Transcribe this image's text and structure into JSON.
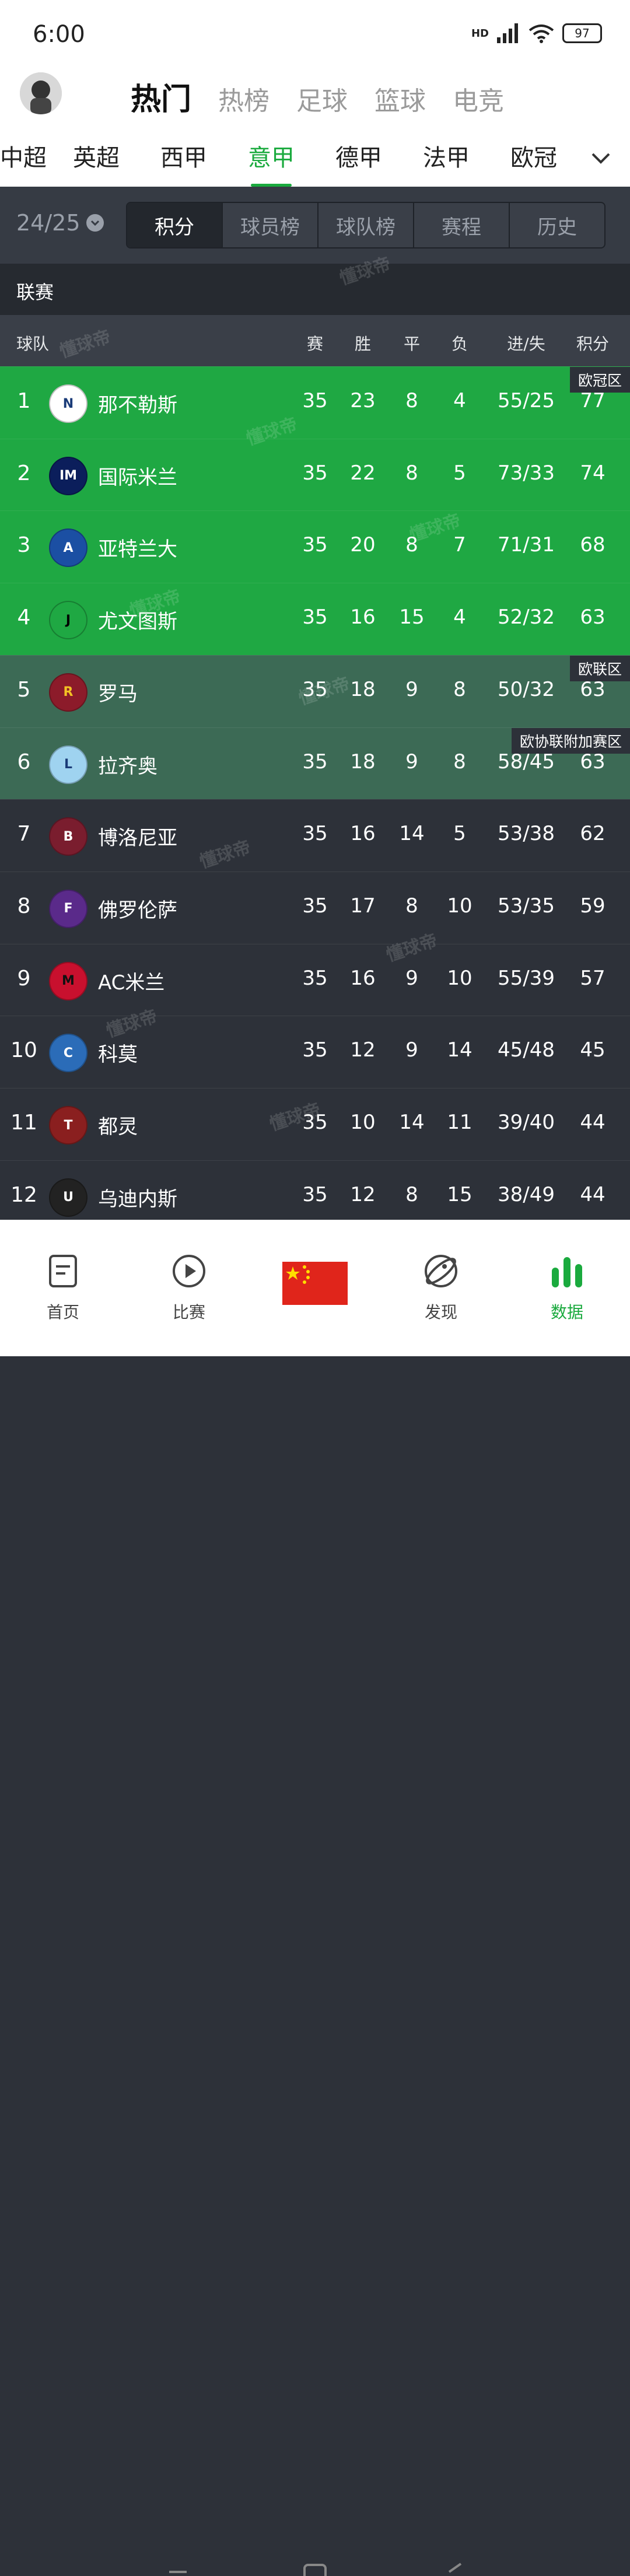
{
  "status_bar": {
    "time": "6:00",
    "network": "HD",
    "battery": "97"
  },
  "header": {
    "top_tabs": [
      "热门",
      "热榜",
      "足球",
      "篮球",
      "电竞"
    ],
    "active_top_tab": "热门",
    "league_tabs": [
      "中超",
      "英超",
      "西甲",
      "意甲",
      "德甲",
      "法甲",
      "欧冠"
    ],
    "active_league_tab": "意甲"
  },
  "filter": {
    "season": "24/25",
    "segments": [
      "积分",
      "球员榜",
      "球队榜",
      "赛程",
      "历史"
    ],
    "active_segment": "积分"
  },
  "league_label": "联赛",
  "table": {
    "headers": {
      "team": "球队",
      "played": "赛",
      "won": "胜",
      "drawn": "平",
      "lost": "负",
      "goals": "进/失",
      "points": "积分"
    },
    "zones": {
      "ucl": "欧冠区",
      "uel": "欧联区",
      "uecl": "欧协联附加赛区"
    },
    "rows": [
      {
        "rank": "1",
        "team": "那不勒斯",
        "logo": "N",
        "p": "35",
        "w": "23",
        "d": "8",
        "l": "4",
        "gd": "55/25",
        "pts": "77"
      },
      {
        "rank": "2",
        "team": "国际米兰",
        "logo": "IM",
        "p": "35",
        "w": "22",
        "d": "8",
        "l": "5",
        "gd": "73/33",
        "pts": "74"
      },
      {
        "rank": "3",
        "team": "亚特兰大",
        "logo": "A",
        "p": "35",
        "w": "20",
        "d": "8",
        "l": "7",
        "gd": "71/31",
        "pts": "68"
      },
      {
        "rank": "4",
        "team": "尤文图斯",
        "logo": "J",
        "p": "35",
        "w": "16",
        "d": "15",
        "l": "4",
        "gd": "52/32",
        "pts": "63"
      },
      {
        "rank": "5",
        "team": "罗马",
        "logo": "R",
        "p": "35",
        "w": "18",
        "d": "9",
        "l": "8",
        "gd": "50/32",
        "pts": "63"
      },
      {
        "rank": "6",
        "team": "拉齐奥",
        "logo": "L",
        "p": "35",
        "w": "18",
        "d": "9",
        "l": "8",
        "gd": "58/45",
        "pts": "63"
      },
      {
        "rank": "7",
        "team": "博洛尼亚",
        "logo": "B",
        "p": "35",
        "w": "16",
        "d": "14",
        "l": "5",
        "gd": "53/38",
        "pts": "62"
      },
      {
        "rank": "8",
        "team": "佛罗伦萨",
        "logo": "F",
        "p": "35",
        "w": "17",
        "d": "8",
        "l": "10",
        "gd": "53/35",
        "pts": "59"
      },
      {
        "rank": "9",
        "team": "AC米兰",
        "logo": "M",
        "p": "35",
        "w": "16",
        "d": "9",
        "l": "10",
        "gd": "55/39",
        "pts": "57"
      },
      {
        "rank": "10",
        "team": "科莫",
        "logo": "C",
        "p": "35",
        "w": "12",
        "d": "9",
        "l": "14",
        "gd": "45/48",
        "pts": "45"
      },
      {
        "rank": "11",
        "team": "都灵",
        "logo": "T",
        "p": "35",
        "w": "10",
        "d": "14",
        "l": "11",
        "gd": "39/40",
        "pts": "44"
      },
      {
        "rank": "12",
        "team": "乌迪内斯",
        "logo": "U",
        "p": "35",
        "w": "12",
        "d": "8",
        "l": "15",
        "gd": "38/49",
        "pts": "44"
      }
    ]
  },
  "bottom_nav": [
    {
      "label": "首页",
      "icon": "document-icon"
    },
    {
      "label": "比赛",
      "icon": "play-icon"
    },
    {
      "label": "",
      "icon": "china-flag-icon"
    },
    {
      "label": "发现",
      "icon": "discover-icon"
    },
    {
      "label": "数据",
      "icon": "bar-chart-icon"
    }
  ],
  "active_nav": "数据",
  "colors": {
    "accent": "#1aaa3e",
    "ucl_zone": "#1fa843",
    "uel_zone": "#3c6a55",
    "table_bg": "#2d3139"
  },
  "watermark": "懂球帝"
}
